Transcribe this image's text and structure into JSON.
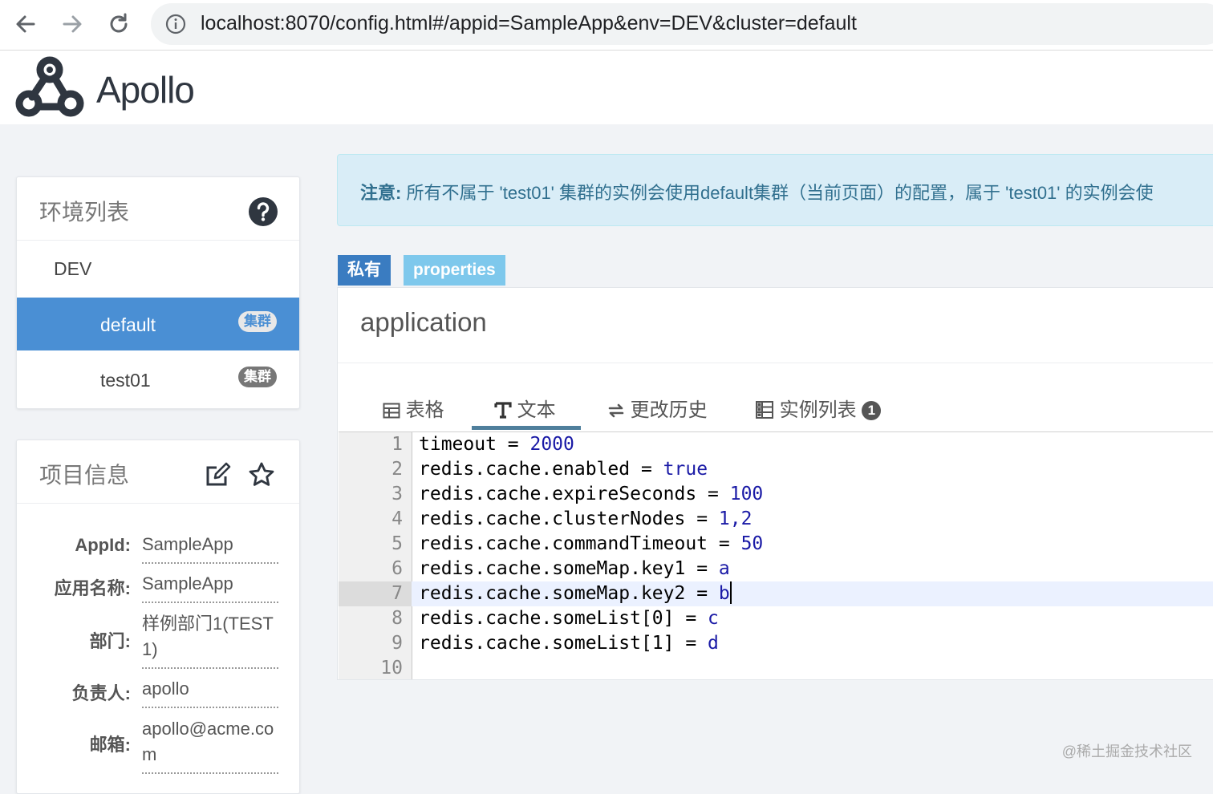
{
  "browser": {
    "url": "localhost:8070/config.html#/appid=SampleApp&env=DEV&cluster=default"
  },
  "app": {
    "name": "Apollo"
  },
  "env_panel": {
    "title": "环境列表",
    "env": "DEV",
    "badge_label": "集群",
    "clusters": [
      {
        "name": "default",
        "active": true
      },
      {
        "name": "test01",
        "active": false
      }
    ]
  },
  "project_panel": {
    "title": "项目信息",
    "rows": [
      {
        "label": "AppId:",
        "value": "SampleApp"
      },
      {
        "label": "应用名称:",
        "value": "SampleApp"
      },
      {
        "label": "部门:",
        "value": "样例部门1(TEST1)"
      },
      {
        "label": "负责人:",
        "value": "apollo"
      },
      {
        "label": "邮箱:",
        "value": "apollo@acme.com"
      }
    ]
  },
  "alert": {
    "prefix": "注意:",
    "text": " 所有不属于 'test01' 集群的实例会使用default集群（当前页面）的配置，属于 'test01' 的实例会使"
  },
  "namespace": {
    "scope_tag": "私有",
    "format_tag": "properties",
    "name": "application",
    "tabs": {
      "table": "表格",
      "text": "文本",
      "history": "更改历史",
      "instances": "实例列表",
      "instances_count": "1"
    },
    "lines": [
      {
        "n": "1",
        "key": "timeout",
        "value": "2000"
      },
      {
        "n": "2",
        "key": "redis.cache.enabled",
        "value": "true"
      },
      {
        "n": "3",
        "key": "redis.cache.expireSeconds",
        "value": "100"
      },
      {
        "n": "4",
        "key": "redis.cache.clusterNodes",
        "value": "1,2"
      },
      {
        "n": "5",
        "key": "redis.cache.commandTimeout",
        "value": "50"
      },
      {
        "n": "6",
        "key": "redis.cache.someMap.key1",
        "value": "a"
      },
      {
        "n": "7",
        "key": "redis.cache.someMap.key2",
        "value": "b"
      },
      {
        "n": "8",
        "key": "redis.cache.someList[0]",
        "value": "c"
      },
      {
        "n": "9",
        "key": "redis.cache.someList[1]",
        "value": "d"
      },
      {
        "n": "10",
        "key": "",
        "value": ""
      }
    ],
    "active_line": "7"
  },
  "watermark": "@稀土掘金技术社区"
}
